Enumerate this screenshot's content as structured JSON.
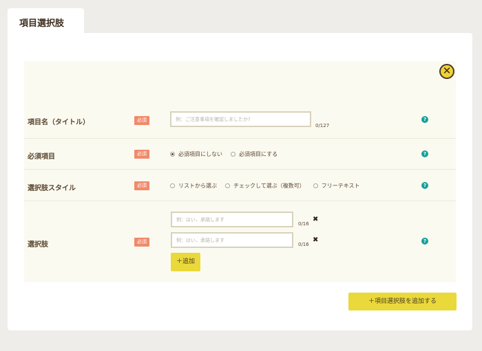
{
  "tab": {
    "title": "項目選択肢"
  },
  "form": {
    "close_label": "✕",
    "required_badge": "必須",
    "help_icon": "?",
    "rows": {
      "title": {
        "label": "項目名（タイトル）",
        "placeholder": "例：ご注意事項を確認しましたか?",
        "counter": "0/127"
      },
      "required": {
        "label": "必須項目",
        "options": [
          "必須項目にしない",
          "必須項目にする"
        ],
        "selected": 0
      },
      "style": {
        "label": "選択肢スタイル",
        "options": [
          "リストから選ぶ",
          "チェックして選ぶ（複数可）",
          "フリーテキスト"
        ]
      },
      "choices": {
        "label": "選択肢",
        "items": [
          {
            "placeholder": "例：はい、承諾します",
            "counter": "0/16",
            "remove": "✖"
          },
          {
            "placeholder": "例：はい、承諾します",
            "counter": "0/16",
            "remove": "✖"
          }
        ],
        "add_label": "＋追加"
      }
    }
  },
  "footer": {
    "add_item_label": "＋項目選択肢を追加する"
  },
  "colors": {
    "background": "#eeedea",
    "panel": "#ffffff",
    "form": "#fbfaf1",
    "badge": "#f08a6b",
    "help": "#16a09a",
    "button": "#ead93a"
  }
}
